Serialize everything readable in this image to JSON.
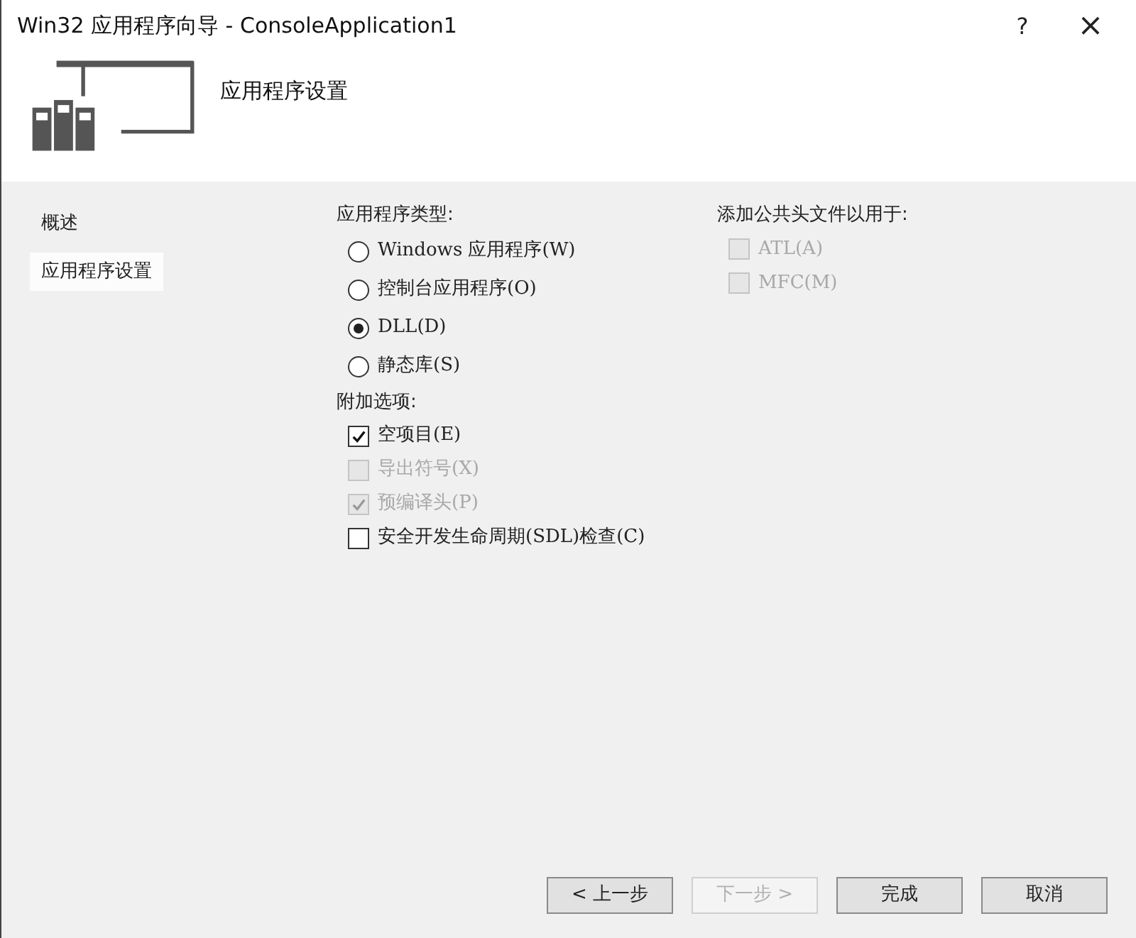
{
  "window": {
    "title": "Win32 应用程序向导 - ConsoleApplication1",
    "help": "?",
    "close": "×"
  },
  "header": {
    "title": "应用程序设置"
  },
  "sidebar": {
    "items": [
      {
        "label": "概述",
        "selected": false
      },
      {
        "label": "应用程序设置",
        "selected": true
      }
    ]
  },
  "app_type": {
    "label": "应用程序类型:",
    "options": [
      {
        "label": "Windows 应用程序(W)",
        "selected": false
      },
      {
        "label": "控制台应用程序(O)",
        "selected": false
      },
      {
        "label": "DLL(D)",
        "selected": true
      },
      {
        "label": "静态库(S)",
        "selected": false
      }
    ]
  },
  "extra_options": {
    "label": "附加选项:",
    "items": [
      {
        "label": "空项目(E)",
        "checked": true,
        "disabled": false
      },
      {
        "label": "导出符号(X)",
        "checked": false,
        "disabled": true
      },
      {
        "label": "预编译头(P)",
        "checked": true,
        "disabled": true
      },
      {
        "label": "安全开发生命周期(SDL)检查(C)",
        "checked": false,
        "disabled": false
      }
    ]
  },
  "common_headers": {
    "label": "添加公共头文件以用于:",
    "items": [
      {
        "label": "ATL(A)",
        "checked": false,
        "disabled": true
      },
      {
        "label": "MFC(M)",
        "checked": false,
        "disabled": true
      }
    ]
  },
  "buttons": [
    {
      "label": "< 上一步",
      "disabled": false
    },
    {
      "label": "下一步 >",
      "disabled": true
    },
    {
      "label": "完成",
      "disabled": false
    },
    {
      "label": "取消",
      "disabled": false
    }
  ]
}
